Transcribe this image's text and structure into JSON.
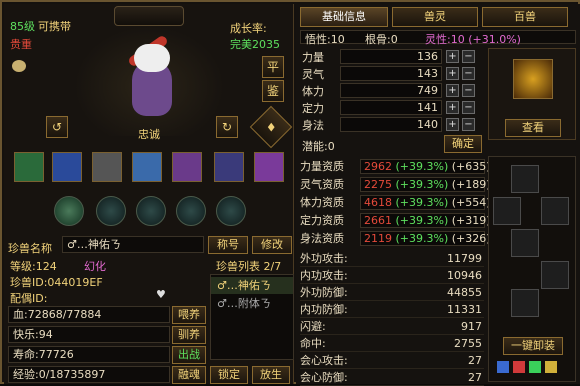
{
  "pet": {
    "level": "85级",
    "carry": "可携带",
    "rarity": "贵重",
    "growth_label": "成长率:",
    "growth_value": "完美2035",
    "personality": "忠诚",
    "name_label": "珍兽名称",
    "name_value": "♂…神佑ㄋ",
    "level_label": "等级:124",
    "morph": "幻化",
    "id_label": "珍兽ID:044019EF",
    "mate_label": "配偶ID:",
    "hp": "血:72868/77884",
    "happy": "快乐:94",
    "life": "寿命:77726",
    "exp": "经验:0/18735897"
  },
  "buttons": {
    "ping": "平",
    "jian": "鉴",
    "rename": "称号",
    "modify": "修改",
    "feed": "喂养",
    "tame": "驯养",
    "fight": "出战",
    "merge": "融魂",
    "lock": "锁定",
    "release": "放生",
    "confirm": "确定",
    "view": "查看",
    "equip_all": "一键卸装"
  },
  "list": {
    "title": "珍兽列表 2/7",
    "items": [
      "♂…神佑ㄋ",
      "♂…附体ㄋ"
    ]
  },
  "tabs": [
    "基础信息",
    "兽灵",
    "百兽"
  ],
  "attr": {
    "wuxing": "悟性:10",
    "genxing": "根骨:0",
    "lingxing": "灵性:10 (+31.0%)",
    "potential": "潜能:0",
    "stats": [
      {
        "label": "力量",
        "value": "136"
      },
      {
        "label": "灵气",
        "value": "143"
      },
      {
        "label": "体力",
        "value": "749"
      },
      {
        "label": "定力",
        "value": "141"
      },
      {
        "label": "身法",
        "value": "140"
      }
    ],
    "aptitudes": [
      {
        "label": "力量资质",
        "base": "2962",
        "pct": " (+39.3%)",
        "add": " (+635)"
      },
      {
        "label": "灵气资质",
        "base": "2275",
        "pct": " (+39.3%)",
        "add": " (+189)"
      },
      {
        "label": "体力资质",
        "base": "4618",
        "pct": " (+39.3%)",
        "add": " (+554)"
      },
      {
        "label": "定力资质",
        "base": "2661",
        "pct": " (+39.3%)",
        "add": " (+319)"
      },
      {
        "label": "身法资质",
        "base": "2119",
        "pct": " (+39.3%)",
        "add": " (+326)"
      }
    ],
    "combat": [
      {
        "label": "外功攻击:",
        "value": "11799"
      },
      {
        "label": "内功攻击:",
        "value": "10946"
      },
      {
        "label": "外功防御:",
        "value": "44855"
      },
      {
        "label": "内功防御:",
        "value": "11331"
      },
      {
        "label": "闪避:",
        "value": "917"
      },
      {
        "label": "命中:",
        "value": "2755"
      },
      {
        "label": "会心攻击:",
        "value": "27"
      },
      {
        "label": "会心防御:",
        "value": "27"
      }
    ]
  },
  "colors": {
    "gold": "#f1d27a",
    "green": "#5ee05e",
    "red": "#e44a3a"
  }
}
